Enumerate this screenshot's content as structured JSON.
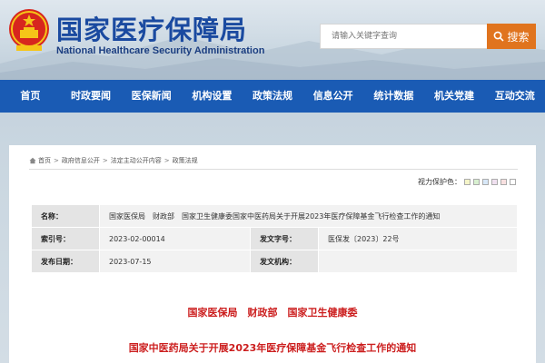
{
  "header": {
    "title": "国家医疗保障局",
    "subtitle": "National Healthcare Security Administration",
    "search_placeholder": "请输入关键字查询",
    "search_button": "搜索"
  },
  "nav": {
    "items": [
      "首页",
      "时政要闻",
      "医保新闻",
      "机构设置",
      "政策法规",
      "信息公开",
      "统计数据",
      "机关党建",
      "互动交流"
    ]
  },
  "breadcrumb": {
    "items": [
      "首页",
      "政府信息公开",
      "法定主动公开内容",
      "政策法规"
    ]
  },
  "vision_protect": {
    "label": "视力保护色：",
    "colors": [
      "#f5f5c8",
      "#d8f0d0",
      "#d8e8f8",
      "#f0e0f0",
      "#f8e0e0",
      "#ffffff"
    ]
  },
  "meta": {
    "name_label": "名称：",
    "name_value": "国家医保局　财政部　国家卫生健康委国家中医药局关于开展2023年医疗保障基金飞行检查工作的通知",
    "index_label": "索引号：",
    "index_value": "2023-02-00014",
    "docno_label": "发文字号：",
    "docno_value": "医保发〔2023〕22号",
    "date_label": "发布日期：",
    "date_value": "2023-07-15",
    "org_label": "发文机构：",
    "org_value": ""
  },
  "article": {
    "issuer": "国家医保局　财政部　国家卫生健康委",
    "title": "国家中医药局关于开展2023年医疗保障基金飞行检查工作的通知"
  },
  "colors": {
    "nav_bg": "#1a5bb4",
    "search_button": "#e0741e",
    "title_blue": "#1a4aa0",
    "article_red": "#cc1f1f"
  }
}
